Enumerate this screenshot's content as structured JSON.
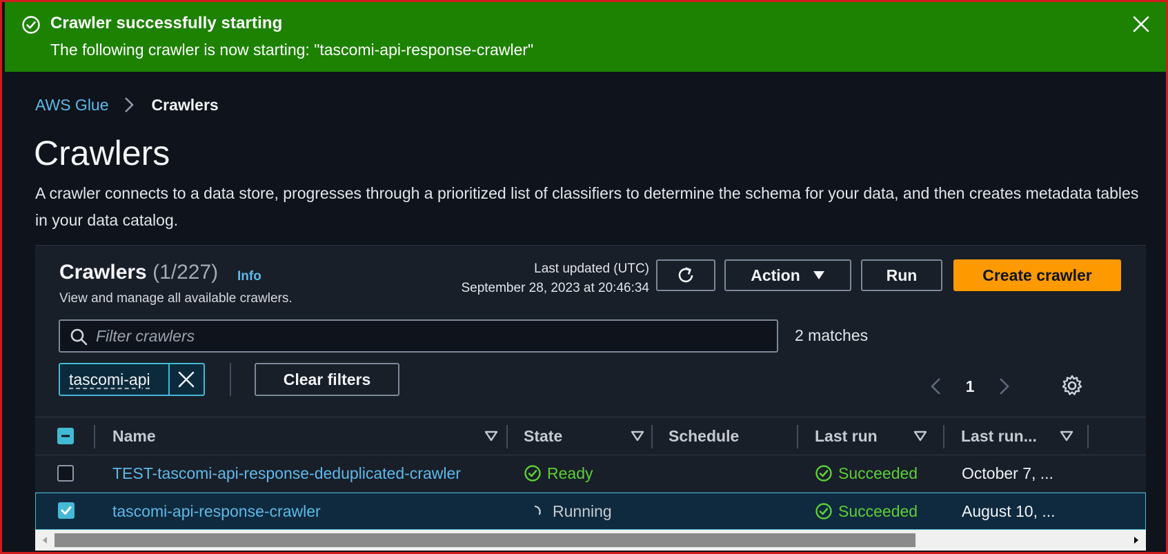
{
  "flash": {
    "title": "Crawler successfully starting",
    "message": "The following crawler is now starting: \"tascomi-api-response-crawler\"",
    "icon": "check-circle-icon",
    "close_icon": "close-icon",
    "color": "#1d8102"
  },
  "breadcrumb": {
    "root": "AWS Glue",
    "current": "Crawlers"
  },
  "page": {
    "title": "Crawlers",
    "description": "A crawler connects to a data store, progresses through a prioritized list of classifiers to determine the schema for your data, and then creates metadata tables in your data catalog."
  },
  "table_header": {
    "title": "Crawlers",
    "count": "(1/227)",
    "info": "Info",
    "subtitle": "View and manage all available crawlers.",
    "last_updated_label": "Last updated (UTC)",
    "last_updated_value": "September 28, 2023 at 20:46:34"
  },
  "toolbar": {
    "refresh_icon": "refresh-icon",
    "action_label": "Action",
    "run_label": "Run",
    "create_label": "Create crawler",
    "create_color": "#ff9900"
  },
  "filter": {
    "placeholder": "Filter crawlers",
    "value": "",
    "matches": "2 matches",
    "token": "tascomi-api",
    "clear_label": "Clear filters"
  },
  "pagination": {
    "current_page": "1"
  },
  "columns": [
    "Name",
    "State",
    "Schedule",
    "Last run",
    "Last run..."
  ],
  "rows": [
    {
      "checked": false,
      "name": "TEST-tascomi-api-response-deduplicated-crawler",
      "state": "Ready",
      "schedule": "",
      "last_run": "Succeeded",
      "last_run_time": "October 7, ..."
    },
    {
      "checked": true,
      "name": "tascomi-api-response-crawler",
      "state": "Running",
      "schedule": "",
      "last_run": "Succeeded",
      "last_run_time": "August 10, ..."
    }
  ]
}
